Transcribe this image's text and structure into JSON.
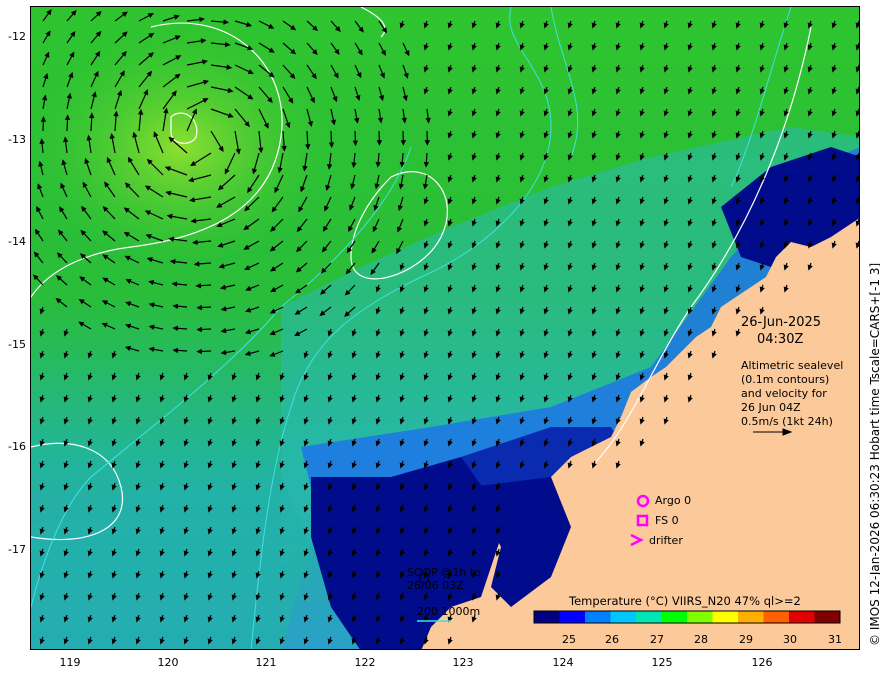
{
  "map": {
    "lat_ticks": [
      "-12",
      "-13",
      "-14",
      "-15",
      "-16",
      "-17"
    ],
    "lon_ticks": [
      "119",
      "120",
      "121",
      "122",
      "123",
      "124",
      "125",
      "126"
    ],
    "side_label": "© IMOS 12-Jan-2026 06:30:23 Hobart time Tscale=CARS+[-1 3]",
    "date": "26-Jun-2025",
    "time": "04:30Z",
    "altimetry_note": [
      "Altimetric sealevel",
      "(0.1m contours)",
      "and velocity for",
      "26 Jun 04Z",
      "0.5m/s (1kt 24h)"
    ],
    "legend": {
      "argo": "Argo 0",
      "fs": "FS 0",
      "drifter": "drifter",
      "soop": [
        "SOOP @1h to",
        "26/06 03Z"
      ],
      "depth": "200  1000m"
    },
    "colorbar": {
      "title": "Temperature (°C) VIIRS_N20 47% ql>=2",
      "ticks": [
        "25",
        "26",
        "27",
        "28",
        "29",
        "30",
        "31"
      ],
      "colors": [
        "#000080",
        "#0000ff",
        "#0080ff",
        "#00c8ff",
        "#00e6b4",
        "#00ff00",
        "#80ff00",
        "#ffff00",
        "#ffb000",
        "#ff6000",
        "#e00000",
        "#800000"
      ]
    },
    "colors": {
      "land": "#fcc99a",
      "sea_green": "#33cc33",
      "sea_blue": "#1a66ff",
      "deep_blue": "#000c8c",
      "contour": "#ffffff",
      "isobath": "#40e0e0",
      "marker": "#ff00ff"
    }
  }
}
